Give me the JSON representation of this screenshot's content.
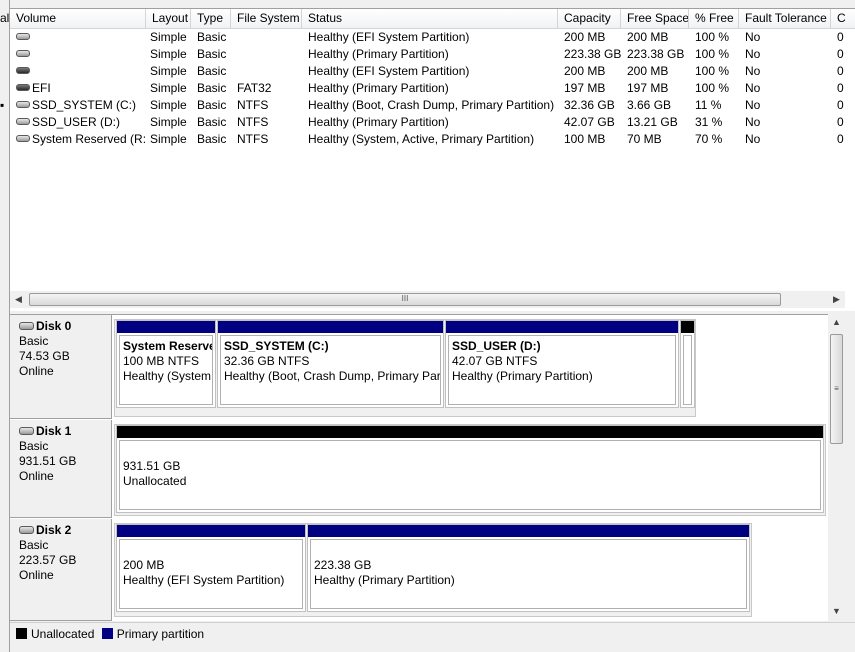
{
  "colors": {
    "primary_partition": "#000080",
    "unallocated": "#000000"
  },
  "left_edge_text": [
    "al"
  ],
  "columns": [
    "Volume",
    "Layout",
    "Type",
    "File System",
    "Status",
    "Capacity",
    "Free Space",
    "% Free",
    "Fault Tolerance",
    "C"
  ],
  "volumes": [
    {
      "icon": "disk-icon",
      "volume": "",
      "layout": "Simple",
      "type": "Basic",
      "fs": "",
      "status": "Healthy (EFI System Partition)",
      "capacity": "200 MB",
      "free": "200 MB",
      "pct": "100 %",
      "fault": "No",
      "c": "0"
    },
    {
      "icon": "disk-icon",
      "volume": "",
      "layout": "Simple",
      "type": "Basic",
      "fs": "",
      "status": "Healthy (Primary Partition)",
      "capacity": "223.38 GB",
      "free": "223.38 GB",
      "pct": "100 %",
      "fault": "No",
      "c": "0"
    },
    {
      "icon": "disk-dark-icon",
      "volume": "",
      "layout": "Simple",
      "type": "Basic",
      "fs": "",
      "status": "Healthy (EFI System Partition)",
      "capacity": "200 MB",
      "free": "200 MB",
      "pct": "100 %",
      "fault": "No",
      "c": "0"
    },
    {
      "icon": "disk-dark-icon",
      "volume": "EFI",
      "layout": "Simple",
      "type": "Basic",
      "fs": "FAT32",
      "status": "Healthy (Primary Partition)",
      "capacity": "197 MB",
      "free": "197 MB",
      "pct": "100 %",
      "fault": "No",
      "c": "0"
    },
    {
      "icon": "disk-icon",
      "volume": "SSD_SYSTEM (C:)",
      "layout": "Simple",
      "type": "Basic",
      "fs": "NTFS",
      "status": "Healthy (Boot, Crash Dump, Primary Partition)",
      "capacity": "32.36 GB",
      "free": "3.66 GB",
      "pct": "11 %",
      "fault": "No",
      "c": "0"
    },
    {
      "icon": "disk-icon",
      "volume": "SSD_USER (D:)",
      "layout": "Simple",
      "type": "Basic",
      "fs": "NTFS",
      "status": "Healthy (Primary Partition)",
      "capacity": "42.07 GB",
      "free": "13.21 GB",
      "pct": "31 %",
      "fault": "No",
      "c": "0"
    },
    {
      "icon": "disk-icon",
      "volume": "System Reserved (R:)",
      "layout": "Simple",
      "type": "Basic",
      "fs": "NTFS",
      "status": "Healthy (System, Active, Primary Partition)",
      "capacity": "100 MB",
      "free": "70 MB",
      "pct": "70 %",
      "fault": "No",
      "c": "0"
    }
  ],
  "hscroll_grip": "III",
  "vscroll_grip": "≡",
  "disks": [
    {
      "name": "Disk 0",
      "type": "Basic",
      "size": "74.53 GB",
      "state": "Online",
      "partitions": [
        {
          "name": "System Reserved",
          "size": "100 MB NTFS",
          "status": "Healthy (System, Active, Primary Partition)"
        },
        {
          "name": "SSD_SYSTEM  (C:)",
          "size": "32.36 GB NTFS",
          "status": "Healthy (Boot, Crash Dump, Primary Partition)"
        },
        {
          "name": "SSD_USER  (D:)",
          "size": "42.07 GB NTFS",
          "status": "Healthy (Primary Partition)"
        },
        {
          "name": "",
          "size": "",
          "status": ""
        }
      ]
    },
    {
      "name": "Disk 1",
      "type": "Basic",
      "size": "931.51 GB",
      "state": "Online",
      "partitions": [
        {
          "name": "",
          "size": "931.51 GB",
          "status": "Unallocated"
        }
      ]
    },
    {
      "name": "Disk 2",
      "type": "Basic",
      "size": "223.57 GB",
      "state": "Online",
      "partitions": [
        {
          "name": "",
          "size": "200 MB",
          "status": "Healthy (EFI System Partition)"
        },
        {
          "name": "",
          "size": "223.38 GB",
          "status": "Healthy (Primary Partition)"
        }
      ]
    }
  ],
  "legend": [
    {
      "label": "Unallocated",
      "color": "#000000"
    },
    {
      "label": "Primary partition",
      "color": "#000080"
    }
  ]
}
